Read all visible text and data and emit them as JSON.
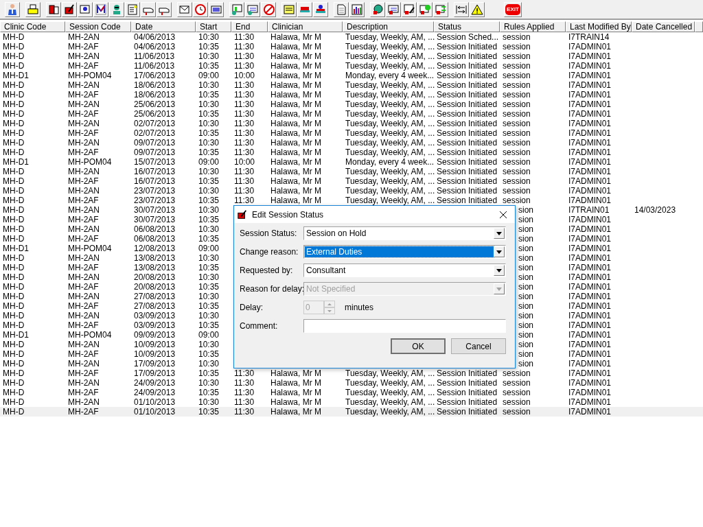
{
  "toolbar": {
    "exit_label": "EXIT"
  },
  "table": {
    "columns": [
      "Clinic Code",
      "Session Code",
      "Date",
      "Start",
      "End",
      "Clinician",
      "Description",
      "Status",
      "Rules Applied",
      "Last Modified By",
      "Date Cancelled"
    ],
    "rows": [
      {
        "cells": [
          "MH-D",
          "MH-2AN",
          "04/06/2013",
          "10:30",
          "11:30",
          "Halawa, Mr M",
          "Tuesday, Weekly, AM, ...",
          "Session Sched...",
          "session",
          "I7TRAIN14"
        ],
        "selected": false
      },
      {
        "cells": [
          "MH-D",
          "MH-2AF",
          "04/06/2013",
          "10:35",
          "11:30",
          "Halawa, Mr M",
          "Tuesday, Weekly, AM, ...",
          "Session Initiated",
          "session",
          "I7ADMIN01"
        ],
        "selected": false
      },
      {
        "cells": [
          "MH-D",
          "MH-2AN",
          "11/06/2013",
          "10:30",
          "11:30",
          "Halawa, Mr M",
          "Tuesday, Weekly, AM, ...",
          "Session Initiated",
          "session",
          "I7ADMIN01"
        ],
        "selected": false
      },
      {
        "cells": [
          "MH-D",
          "MH-2AF",
          "11/06/2013",
          "10:35",
          "11:30",
          "Halawa, Mr M",
          "Tuesday, Weekly, AM, ...",
          "Session Initiated",
          "session",
          "I7ADMIN01"
        ],
        "selected": false
      },
      {
        "cells": [
          "MH-D1",
          "MH-POM04",
          "17/06/2013",
          "09:00",
          "10:00",
          "Halawa, Mr M",
          "Monday, every 4 week...",
          "Session Initiated",
          "session",
          "I7ADMIN01"
        ],
        "selected": false
      },
      {
        "cells": [
          "MH-D",
          "MH-2AN",
          "18/06/2013",
          "10:30",
          "11:30",
          "Halawa, Mr M",
          "Tuesday, Weekly, AM, ...",
          "Session Initiated",
          "session",
          "I7ADMIN01"
        ],
        "selected": false
      },
      {
        "cells": [
          "MH-D",
          "MH-2AF",
          "18/06/2013",
          "10:35",
          "11:30",
          "Halawa, Mr M",
          "Tuesday, Weekly, AM, ...",
          "Session Initiated",
          "session",
          "I7ADMIN01"
        ],
        "selected": false
      },
      {
        "cells": [
          "MH-D",
          "MH-2AN",
          "25/06/2013",
          "10:30",
          "11:30",
          "Halawa, Mr M",
          "Tuesday, Weekly, AM, ...",
          "Session Initiated",
          "session",
          "I7ADMIN01"
        ],
        "selected": false
      },
      {
        "cells": [
          "MH-D",
          "MH-2AF",
          "25/06/2013",
          "10:35",
          "11:30",
          "Halawa, Mr M",
          "Tuesday, Weekly, AM, ...",
          "Session Initiated",
          "session",
          "I7ADMIN01"
        ],
        "selected": false
      },
      {
        "cells": [
          "MH-D",
          "MH-2AN",
          "02/07/2013",
          "10:30",
          "11:30",
          "Halawa, Mr M",
          "Tuesday, Weekly, AM, ...",
          "Session Initiated",
          "session",
          "I7ADMIN01"
        ],
        "selected": false
      },
      {
        "cells": [
          "MH-D",
          "MH-2AF",
          "02/07/2013",
          "10:35",
          "11:30",
          "Halawa, Mr M",
          "Tuesday, Weekly, AM, ...",
          "Session Initiated",
          "session",
          "I7ADMIN01"
        ],
        "selected": false
      },
      {
        "cells": [
          "MH-D",
          "MH-2AN",
          "09/07/2013",
          "10:30",
          "11:30",
          "Halawa, Mr M",
          "Tuesday, Weekly, AM, ...",
          "Session Initiated",
          "session",
          "I7ADMIN01"
        ],
        "selected": false
      },
      {
        "cells": [
          "MH-D",
          "MH-2AF",
          "09/07/2013",
          "10:35",
          "11:30",
          "Halawa, Mr M",
          "Tuesday, Weekly, AM, ...",
          "Session Initiated",
          "session",
          "I7ADMIN01"
        ],
        "selected": false
      },
      {
        "cells": [
          "MH-D1",
          "MH-POM04",
          "15/07/2013",
          "09:00",
          "10:00",
          "Halawa, Mr M",
          "Monday, every 4 week...",
          "Session Initiated",
          "session",
          "I7ADMIN01"
        ],
        "selected": false
      },
      {
        "cells": [
          "MH-D",
          "MH-2AN",
          "16/07/2013",
          "10:30",
          "11:30",
          "Halawa, Mr M",
          "Tuesday, Weekly, AM, ...",
          "Session Initiated",
          "session",
          "I7ADMIN01"
        ],
        "selected": false
      },
      {
        "cells": [
          "MH-D",
          "MH-2AF",
          "16/07/2013",
          "10:35",
          "11:30",
          "Halawa, Mr M",
          "Tuesday, Weekly, AM, ...",
          "Session Initiated",
          "session",
          "I7ADMIN01"
        ],
        "selected": false
      },
      {
        "cells": [
          "MH-D",
          "MH-2AN",
          "23/07/2013",
          "10:30",
          "11:30",
          "Halawa, Mr M",
          "Tuesday, Weekly, AM, ...",
          "Session Initiated",
          "session",
          "I7ADMIN01"
        ],
        "selected": false
      },
      {
        "cells": [
          "MH-D",
          "MH-2AF",
          "23/07/2013",
          "10:35",
          "11:30",
          "Halawa, Mr M",
          "Tuesday, Weekly, AM, ...",
          "Session Initiated",
          "session",
          "I7ADMIN01"
        ],
        "selected": false
      },
      {
        "cells": [
          "MH-D",
          "MH-2AN",
          "30/07/2013",
          "10:30",
          "",
          "",
          "",
          "",
          "sion",
          "I7TRAIN01",
          "14/03/2023"
        ],
        "selected": false
      },
      {
        "cells": [
          "MH-D",
          "MH-2AF",
          "30/07/2013",
          "10:35",
          "",
          "",
          "",
          "",
          "sion",
          "I7ADMIN01"
        ],
        "selected": false
      },
      {
        "cells": [
          "MH-D",
          "MH-2AN",
          "06/08/2013",
          "10:30",
          "",
          "",
          "",
          "",
          "sion",
          "I7ADMIN01"
        ],
        "selected": false
      },
      {
        "cells": [
          "MH-D",
          "MH-2AF",
          "06/08/2013",
          "10:35",
          "",
          "",
          "",
          "",
          "sion",
          "I7ADMIN01"
        ],
        "selected": false
      },
      {
        "cells": [
          "MH-D1",
          "MH-POM04",
          "12/08/2013",
          "09:00",
          "",
          "",
          "",
          "",
          "sion",
          "I7ADMIN01"
        ],
        "selected": false
      },
      {
        "cells": [
          "MH-D",
          "MH-2AN",
          "13/08/2013",
          "10:30",
          "",
          "",
          "",
          "",
          "sion",
          "I7ADMIN01"
        ],
        "selected": false
      },
      {
        "cells": [
          "MH-D",
          "MH-2AF",
          "13/08/2013",
          "10:35",
          "",
          "",
          "",
          "",
          "sion",
          "I7ADMIN01"
        ],
        "selected": false
      },
      {
        "cells": [
          "MH-D",
          "MH-2AN",
          "20/08/2013",
          "10:30",
          "",
          "",
          "",
          "",
          "sion",
          "I7ADMIN01"
        ],
        "selected": false
      },
      {
        "cells": [
          "MH-D",
          "MH-2AF",
          "20/08/2013",
          "10:35",
          "",
          "",
          "",
          "",
          "sion",
          "I7ADMIN01"
        ],
        "selected": false
      },
      {
        "cells": [
          "MH-D",
          "MH-2AN",
          "27/08/2013",
          "10:30",
          "",
          "",
          "",
          "",
          "sion",
          "I7ADMIN01"
        ],
        "selected": false
      },
      {
        "cells": [
          "MH-D",
          "MH-2AF",
          "27/08/2013",
          "10:35",
          "",
          "",
          "",
          "",
          "sion",
          "I7ADMIN01"
        ],
        "selected": false
      },
      {
        "cells": [
          "MH-D",
          "MH-2AN",
          "03/09/2013",
          "10:30",
          "",
          "",
          "",
          "",
          "sion",
          "I7ADMIN01"
        ],
        "selected": false
      },
      {
        "cells": [
          "MH-D",
          "MH-2AF",
          "03/09/2013",
          "10:35",
          "",
          "",
          "",
          "",
          "sion",
          "I7ADMIN01"
        ],
        "selected": false
      },
      {
        "cells": [
          "MH-D1",
          "MH-POM04",
          "09/09/2013",
          "09:00",
          "",
          "",
          "",
          "",
          "sion",
          "I7ADMIN01"
        ],
        "selected": false
      },
      {
        "cells": [
          "MH-D",
          "MH-2AN",
          "10/09/2013",
          "10:30",
          "",
          "",
          "",
          "",
          "sion",
          "I7ADMIN01"
        ],
        "selected": false
      },
      {
        "cells": [
          "MH-D",
          "MH-2AF",
          "10/09/2013",
          "10:35",
          "",
          "",
          "",
          "",
          "sion",
          "I7ADMIN01"
        ],
        "selected": false
      },
      {
        "cells": [
          "MH-D",
          "MH-2AN",
          "17/09/2013",
          "10:30",
          "",
          "",
          "",
          "",
          "sion",
          "I7ADMIN01"
        ],
        "selected": false
      },
      {
        "cells": [
          "MH-D",
          "MH-2AF",
          "17/09/2013",
          "10:35",
          "11:30",
          "Halawa, Mr M",
          "Tuesday, Weekly, AM, ...",
          "Session Initiated",
          "session",
          "I7ADMIN01"
        ],
        "selected": false
      },
      {
        "cells": [
          "MH-D",
          "MH-2AN",
          "24/09/2013",
          "10:30",
          "11:30",
          "Halawa, Mr M",
          "Tuesday, Weekly, AM, ...",
          "Session Initiated",
          "session",
          "I7ADMIN01"
        ],
        "selected": false
      },
      {
        "cells": [
          "MH-D",
          "MH-2AF",
          "24/09/2013",
          "10:35",
          "11:30",
          "Halawa, Mr M",
          "Tuesday, Weekly, AM, ...",
          "Session Initiated",
          "session",
          "I7ADMIN01"
        ],
        "selected": false
      },
      {
        "cells": [
          "MH-D",
          "MH-2AN",
          "01/10/2013",
          "10:30",
          "11:30",
          "Halawa, Mr M",
          "Tuesday, Weekly, AM, ...",
          "Session Initiated",
          "session",
          "I7ADMIN01"
        ],
        "selected": false
      },
      {
        "cells": [
          "MH-D",
          "MH-2AF",
          "01/10/2013",
          "10:35",
          "11:30",
          "Halawa, Mr M",
          "Tuesday, Weekly, AM, ...",
          "Session Initiated",
          "session",
          "I7ADMIN01"
        ],
        "selected": true
      }
    ]
  },
  "dialog": {
    "title": "Edit Session Status",
    "fields": [
      {
        "kind": "dropdown",
        "label": "Session Status:",
        "value": "Session on Hold",
        "focused": false,
        "disabled": false
      },
      {
        "kind": "dropdown",
        "label": "Change reason:",
        "value": "External Duties",
        "focused": true,
        "disabled": false
      },
      {
        "kind": "dropdown",
        "label": "Requested by:",
        "value": "Consultant",
        "focused": false,
        "disabled": false
      },
      {
        "kind": "dropdown",
        "label": "Reason for delay:",
        "value": "Not Specified",
        "focused": false,
        "disabled": true
      },
      {
        "kind": "spinner",
        "label": "Delay:",
        "value": "0",
        "unit": "minutes",
        "disabled": true
      },
      {
        "kind": "text",
        "label": "Comment:"
      }
    ],
    "buttons": [
      {
        "label": "OK",
        "default": true
      },
      {
        "label": "Cancel",
        "default": false
      }
    ]
  }
}
